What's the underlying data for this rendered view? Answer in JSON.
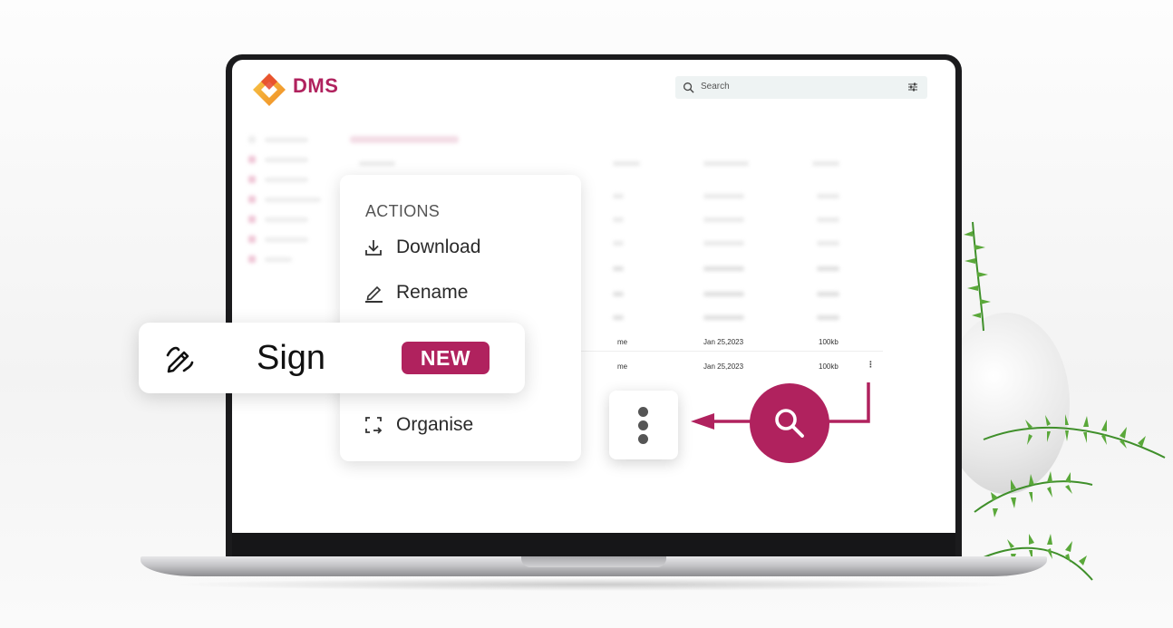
{
  "app": {
    "logo_text": "DMS",
    "brand_color": "#b0225e"
  },
  "search": {
    "placeholder": "Search",
    "icon": "search-icon",
    "filter_icon": "filter-icon"
  },
  "table": {
    "rows": [
      {
        "owner": "me",
        "modified": "Jan 25,2023",
        "size": "100kb"
      },
      {
        "owner": "me",
        "modified": "Jan 25,2023",
        "size": "100kb"
      }
    ],
    "row_menu_glyph": "⋮"
  },
  "actions_menu": {
    "title": "ACTIONS",
    "items": [
      {
        "label": "Download",
        "icon": "download-icon"
      },
      {
        "label": "Rename",
        "icon": "rename-pencil-icon"
      },
      {
        "label": "Organise",
        "icon": "organise-icon"
      }
    ]
  },
  "sign_feature": {
    "label": "Sign",
    "badge": "NEW",
    "icon": "sign-pen-icon"
  },
  "callouts": {
    "kebab_icon": "kebab-menu-icon",
    "search_icon": "search-icon"
  }
}
